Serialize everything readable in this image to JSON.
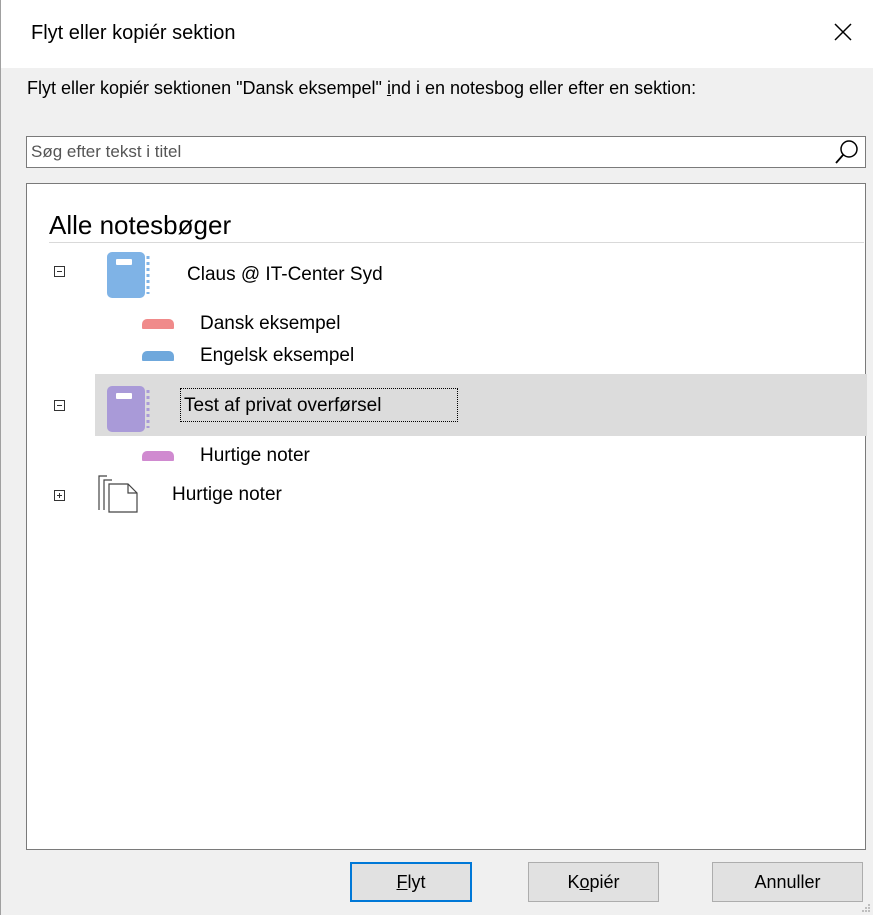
{
  "dialog": {
    "title": "Flyt eller kopiér sektion",
    "instruction_before": "Flyt eller kopiér sektionen \"Dansk eksempel\" ",
    "instruction_mnemonic": "i",
    "instruction_after": "nd i en notesbog eller efter en sektion:"
  },
  "search": {
    "placeholder": "Søg efter tekst i titel",
    "value": ""
  },
  "tree": {
    "header": "Alle notesbøger",
    "notebooks": [
      {
        "label": "Claus @ IT-Center Syd",
        "icon_color": "#7fb3e6",
        "expanded": true,
        "sections": [
          {
            "label": "Dansk eksempel",
            "color": "#f08a8a"
          },
          {
            "label": "Engelsk eksempel",
            "color": "#6fa8dc"
          }
        ]
      },
      {
        "label": "Test af privat overførsel",
        "icon_color": "#a99ad8",
        "expanded": true,
        "selected": true,
        "sections": [
          {
            "label": "Hurtige noter",
            "color": "#d08ad0"
          }
        ]
      },
      {
        "label": "Hurtige noter",
        "icon": "pages-icon",
        "expanded": false
      }
    ]
  },
  "buttons": {
    "move_mnemonic": "F",
    "move_rest": "lyt",
    "copy_before": "K",
    "copy_mnemonic": "o",
    "copy_after": "piér",
    "cancel": "Annuller"
  },
  "colors": {
    "accent": "#0078d7",
    "selection": "#dcdcdc"
  }
}
